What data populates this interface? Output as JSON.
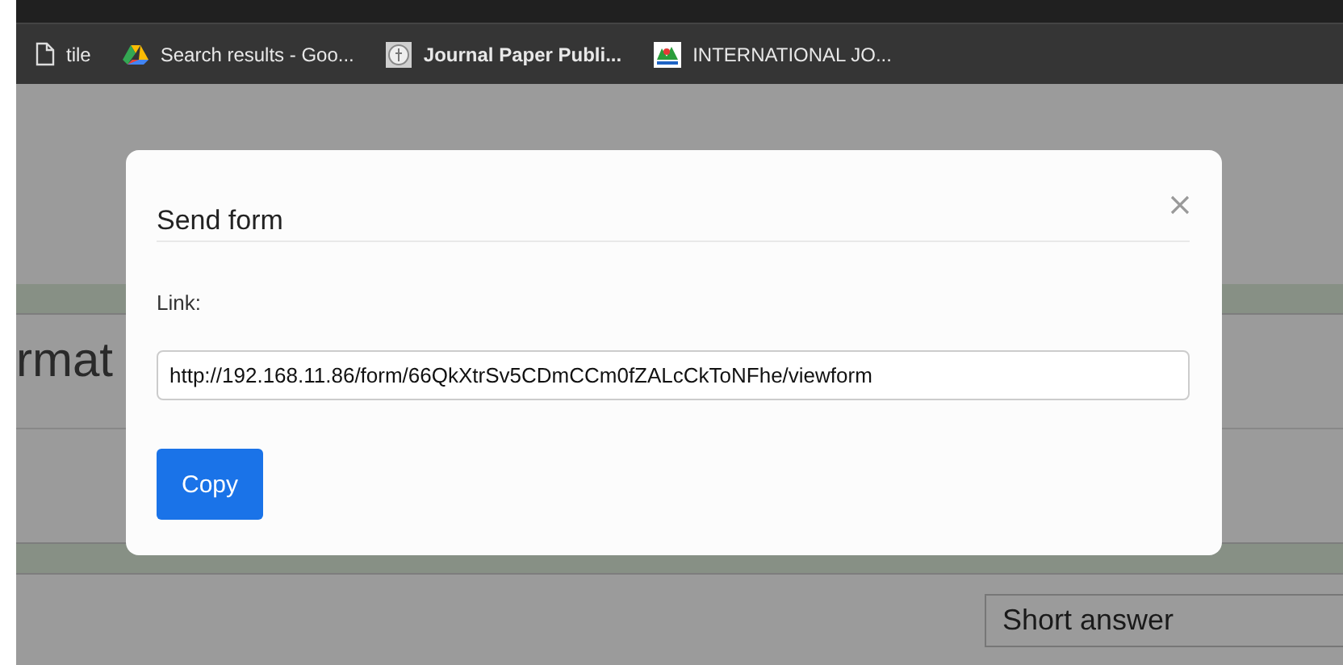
{
  "bookmarks": [
    {
      "kind": "page",
      "label": "tile"
    },
    {
      "kind": "drive",
      "label": "Search results - Goo..."
    },
    {
      "kind": "seal",
      "label": "Journal Paper Publi..."
    },
    {
      "kind": "logo",
      "label": "INTERNATIONAL JO..."
    }
  ],
  "page": {
    "heading": "rmat",
    "question_type": "Short answer"
  },
  "dialog": {
    "title": "Send form",
    "link_label": "Link:",
    "link_value": "http://192.168.11.86/form/66QkXtrSv5CDmCCm0fZALcCkToNFhe/viewform",
    "button": "Copy"
  }
}
